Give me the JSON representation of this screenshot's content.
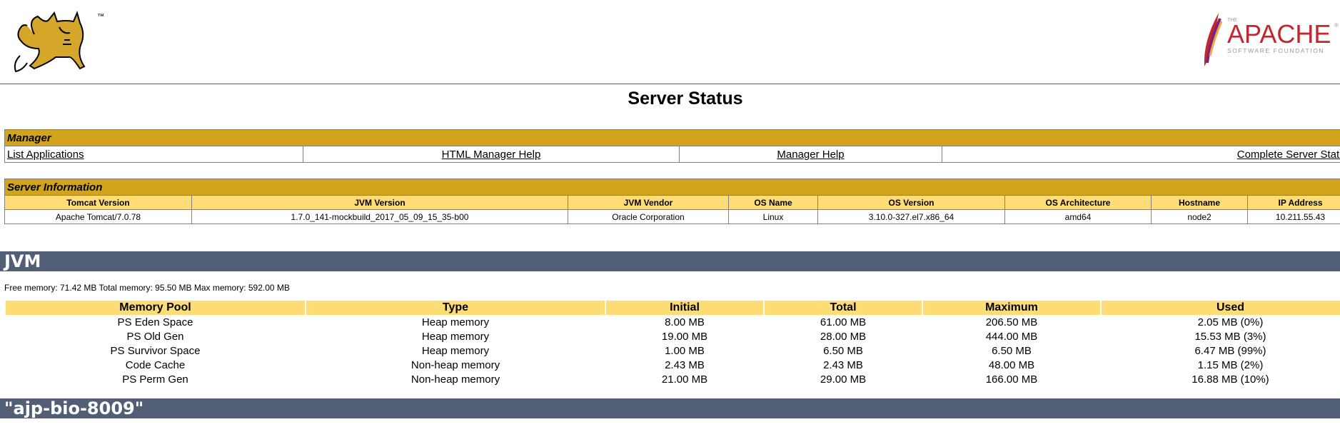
{
  "header": {
    "tm_mark": "™",
    "apache_small": "THE",
    "apache_big": "APACHE",
    "apache_sub": "SOFTWARE FOUNDATION",
    "apache_reg": "®"
  },
  "page_title": "Server Status",
  "manager": {
    "title": "Manager",
    "links": [
      "List Applications",
      "HTML Manager Help",
      "Manager Help",
      "Complete Server Status"
    ]
  },
  "server_info": {
    "title": "Server Information",
    "headers": [
      "Tomcat Version",
      "JVM Version",
      "JVM Vendor",
      "OS Name",
      "OS Version",
      "OS Architecture",
      "Hostname",
      "IP Address"
    ],
    "values": [
      "Apache Tomcat/7.0.78",
      "1.7.0_141-mockbuild_2017_05_09_15_35-b00",
      "Oracle Corporation",
      "Linux",
      "3.10.0-327.el7.x86_64",
      "amd64",
      "node2",
      "10.211.55.43"
    ]
  },
  "jvm": {
    "title": "JVM",
    "memory_line": "Free memory: 71.42 MB Total memory: 95.50 MB Max memory: 592.00 MB",
    "pool_headers": [
      "Memory Pool",
      "Type",
      "Initial",
      "Total",
      "Maximum",
      "Used"
    ],
    "pools": [
      [
        "PS Eden Space",
        "Heap memory",
        "8.00 MB",
        "61.00 MB",
        "206.50 MB",
        "2.05 MB (0%)"
      ],
      [
        "PS Old Gen",
        "Heap memory",
        "19.00 MB",
        "28.00 MB",
        "444.00 MB",
        "15.53 MB (3%)"
      ],
      [
        "PS Survivor Space",
        "Heap memory",
        "1.00 MB",
        "6.50 MB",
        "6.50 MB",
        "6.47 MB (99%)"
      ],
      [
        "Code Cache",
        "Non-heap memory",
        "2.43 MB",
        "2.43 MB",
        "48.00 MB",
        "1.15 MB (2%)"
      ],
      [
        "PS Perm Gen",
        "Non-heap memory",
        "21.00 MB",
        "29.00 MB",
        "166.00 MB",
        "16.88 MB (10%)"
      ]
    ]
  },
  "ajp": {
    "title": "\"ajp-bio-8009\""
  },
  "colors": {
    "section_bar": "#525d76",
    "title_row": "#d2a41c",
    "header_row": "#ffdc75",
    "apache_red": "#c4262e"
  }
}
